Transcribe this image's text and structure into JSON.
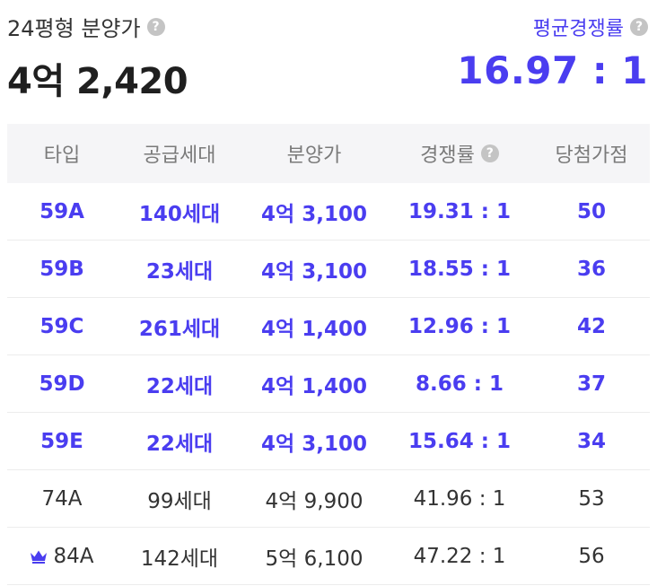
{
  "header": {
    "price_label": "24평형 분양가",
    "price_value": "4억 2,420",
    "competition_label": "평균경쟁률",
    "competition_value": "16.97 : 1",
    "help_glyph": "?"
  },
  "colors": {
    "accent": "#4a3df0",
    "header_bg": "#f5f5f7",
    "muted": "#7a7a7a",
    "help_icon": "#c4c4c4"
  },
  "table": {
    "columns": [
      "타입",
      "공급세대",
      "분양가",
      "경쟁률",
      "당첨가점"
    ],
    "rows": [
      {
        "type": "59A",
        "supply": "140세대",
        "price": "4억 3,100",
        "rate": "19.31 : 1",
        "score": "50",
        "highlight": true,
        "icon": ""
      },
      {
        "type": "59B",
        "supply": "23세대",
        "price": "4억 3,100",
        "rate": "18.55 : 1",
        "score": "36",
        "highlight": true,
        "icon": ""
      },
      {
        "type": "59C",
        "supply": "261세대",
        "price": "4억 1,400",
        "rate": "12.96 : 1",
        "score": "42",
        "highlight": true,
        "icon": ""
      },
      {
        "type": "59D",
        "supply": "22세대",
        "price": "4억 1,400",
        "rate": "8.66 : 1",
        "score": "37",
        "highlight": true,
        "icon": ""
      },
      {
        "type": "59E",
        "supply": "22세대",
        "price": "4억 3,100",
        "rate": "15.64 : 1",
        "score": "34",
        "highlight": true,
        "icon": ""
      },
      {
        "type": "74A",
        "supply": "99세대",
        "price": "4억 9,900",
        "rate": "41.96 : 1",
        "score": "53",
        "highlight": false,
        "icon": ""
      },
      {
        "type": "84A",
        "supply": "142세대",
        "price": "5억 6,100",
        "rate": "47.22 : 1",
        "score": "56",
        "highlight": false,
        "icon": "crown-icon"
      }
    ]
  }
}
